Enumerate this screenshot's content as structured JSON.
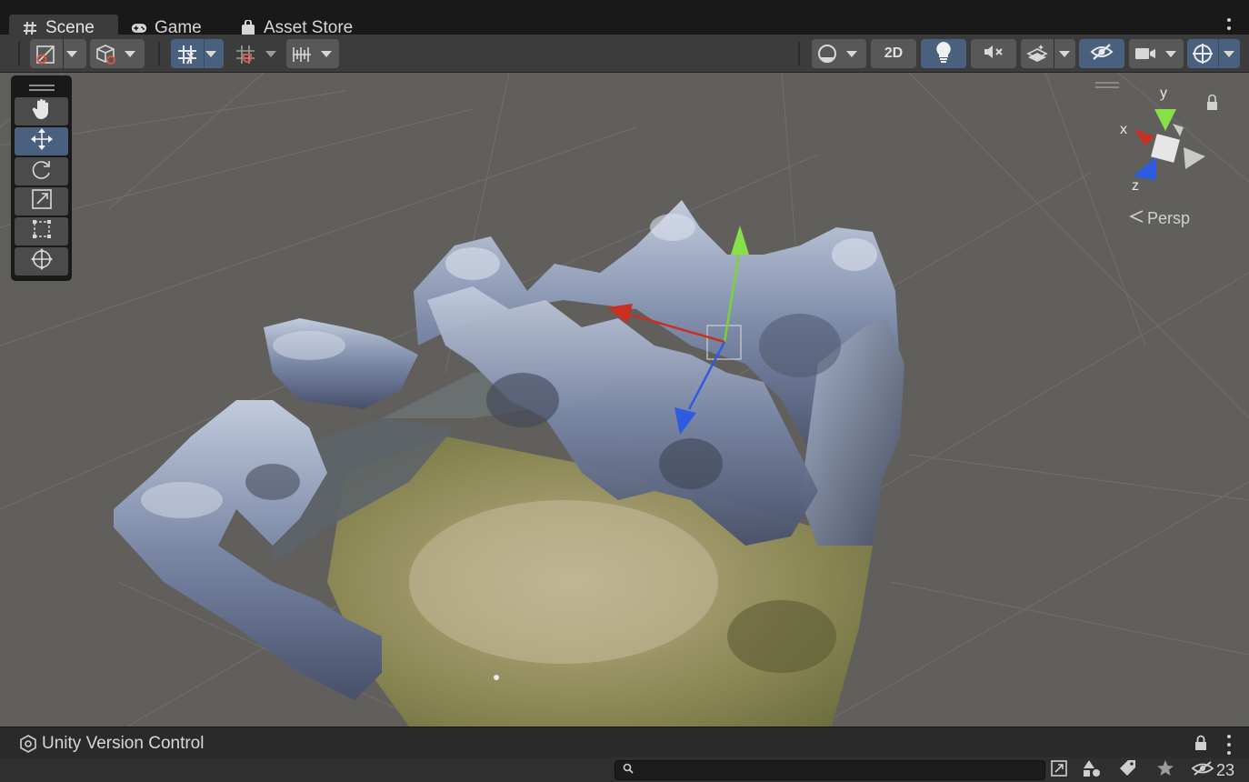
{
  "tabs": [
    {
      "label": "Scene",
      "icon": "hash-icon",
      "active": true
    },
    {
      "label": "Game",
      "icon": "gamepad-icon",
      "active": false
    },
    {
      "label": "Asset Store",
      "icon": "shopping-bag-icon",
      "active": false
    }
  ],
  "toolbar": {
    "two_d_label": "2D"
  },
  "tools": [
    {
      "name": "hand-tool",
      "icon": "hand-icon"
    },
    {
      "name": "move-tool",
      "icon": "move-arrows-icon",
      "active": true
    },
    {
      "name": "rotate-tool",
      "icon": "rotate-icon"
    },
    {
      "name": "scale-tool",
      "icon": "scale-icon"
    },
    {
      "name": "rect-tool",
      "icon": "rect-transform-icon"
    },
    {
      "name": "transform-tool",
      "icon": "transform-icon"
    }
  ],
  "gizmo": {
    "axis_x": "x",
    "axis_y": "y",
    "axis_z": "z",
    "projection": "Persp"
  },
  "version_control": {
    "title": "Unity Version Control"
  },
  "status": {
    "hidden_count": "23"
  },
  "colors": {
    "accent_blue": "#4a607f",
    "axis_x": "#d23a2a",
    "axis_y": "#7ad33a",
    "axis_z": "#2f5be0"
  }
}
